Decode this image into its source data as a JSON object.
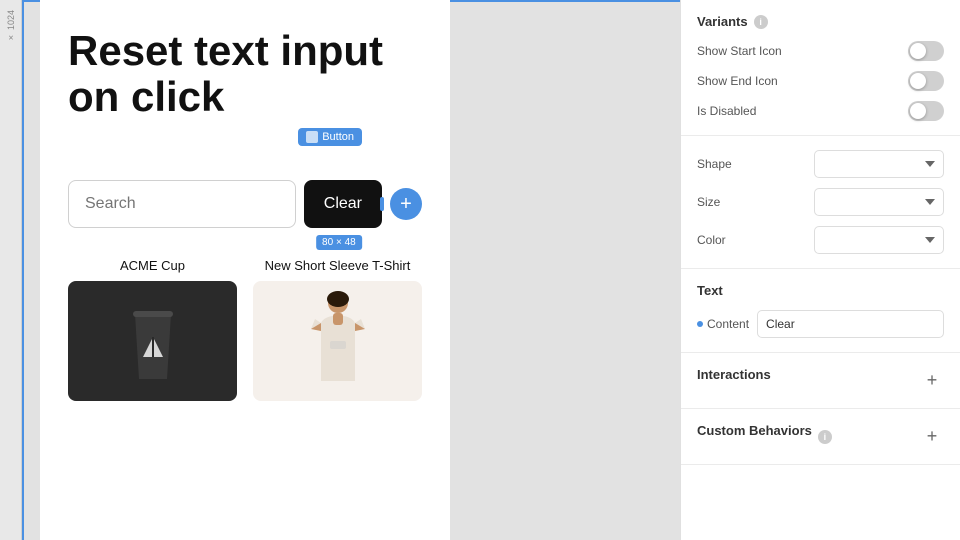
{
  "page": {
    "title": "Reset text input on click",
    "ruler_label": "× 1024"
  },
  "canvas": {
    "search_placeholder": "Search",
    "clear_button_label": "Clear",
    "button_tag_label": "Button",
    "size_badge": "80 × 48",
    "add_button_label": "+",
    "products": [
      {
        "name": "ACME Cup",
        "type": "cup"
      },
      {
        "name": "New Short Sleeve T-Shirt",
        "type": "tshirt"
      }
    ]
  },
  "right_panel": {
    "variants_section": {
      "title": "Variants",
      "rows": [
        {
          "label": "Show Start Icon",
          "toggle_on": false
        },
        {
          "label": "Show End Icon",
          "toggle_on": false
        },
        {
          "label": "Is Disabled",
          "toggle_on": false
        }
      ]
    },
    "shape_row": {
      "label": "Shape"
    },
    "size_row": {
      "label": "Size"
    },
    "color_row": {
      "label": "Color"
    },
    "text_section": {
      "title": "Text",
      "content_label": "Content",
      "content_value": "Clear"
    },
    "interactions_section": {
      "title": "Interactions"
    },
    "custom_behaviors_section": {
      "title": "Custom Behaviors"
    }
  }
}
